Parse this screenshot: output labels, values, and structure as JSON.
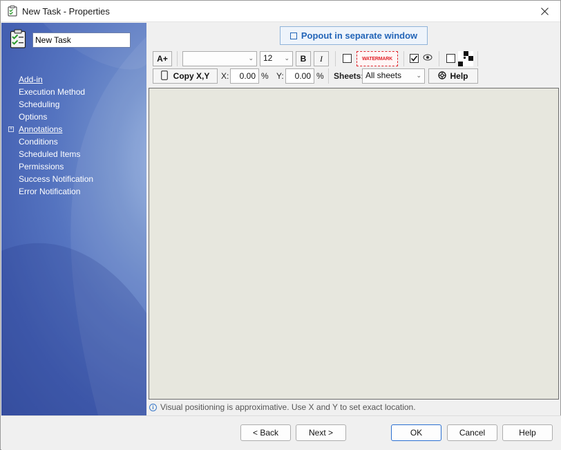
{
  "window": {
    "title": "New Task - Properties"
  },
  "sidebar": {
    "task_name": "New Task",
    "items": [
      {
        "label": "Add-in",
        "link": true
      },
      {
        "label": "Execution Method",
        "link": false
      },
      {
        "label": "Scheduling",
        "link": false
      },
      {
        "label": "Options",
        "link": false
      },
      {
        "label": "Annotations",
        "link": true,
        "expandable": true
      },
      {
        "label": "Conditions",
        "link": false
      },
      {
        "label": "Scheduled Items",
        "link": false
      },
      {
        "label": "Permissions",
        "link": false
      },
      {
        "label": "Success Notification",
        "link": false
      },
      {
        "label": "Error Notification",
        "link": false
      }
    ]
  },
  "toolbar": {
    "popout_label": "Popout in separate window",
    "font_increase_label": "A+",
    "font_family_value": "",
    "font_size_value": "12",
    "bold_label": "B",
    "italic_label": "I",
    "watermark_label": "WATERMARK",
    "visible_checked": true,
    "copy_xy_label": "Copy X,Y",
    "x_label": "X:",
    "x_value": "0.00",
    "x_unit": "%",
    "y_label": "Y:",
    "y_value": "0.00",
    "y_unit": "%",
    "sheets_label": "Sheets:",
    "sheets_value": "All sheets",
    "help_label": "Help"
  },
  "hint": {
    "text": "Visual positioning is approximative. Use X and Y to set exact location."
  },
  "footer": {
    "back_label": "< Back",
    "next_label": "Next >",
    "ok_label": "OK",
    "cancel_label": "Cancel",
    "help_label": "Help"
  },
  "colors": {
    "accent": "#2365b8",
    "sidebar": "#4561b2",
    "canvas": "#e7e7de",
    "watermark": "#e0242b"
  },
  "icons": {
    "title": "task-checklist-icon",
    "close": "close-icon",
    "popout": "popout-window-icon",
    "help": "lifebuoy-icon",
    "info": "info-icon"
  }
}
